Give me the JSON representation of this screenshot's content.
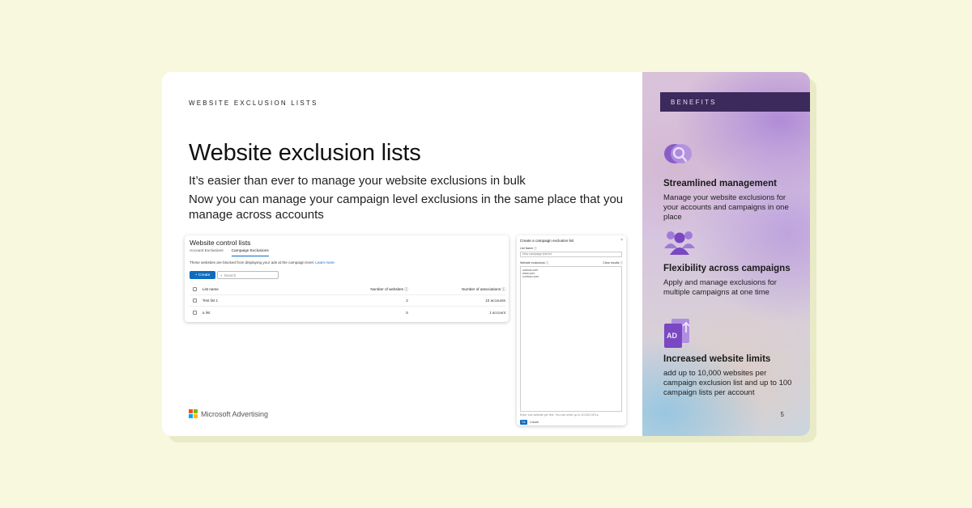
{
  "slide": {
    "eyebrow": "WEBSITE EXCLUSION LISTS",
    "title": "Website exclusion lists",
    "subtitle1": "It’s easier than ever to manage your website exclusions in bulk",
    "subtitle2": "Now you can manage your campaign level exclusions in the same place that you manage across accounts",
    "brand": "Microsoft Advertising",
    "page_number": "5"
  },
  "wcl": {
    "title": "Website control lists",
    "tabs": [
      "Account Exclusions",
      "Campaign Exclusions"
    ],
    "description": "These websites are blocked from displaying your ads at the campaign level.",
    "learn_more": "Learn more",
    "create_label": "+ Create",
    "search_placeholder": "Search",
    "columns": [
      "List name",
      "Number of websites ⓘ",
      "Number of associations ⓘ"
    ],
    "rows": [
      [
        "Test list 1",
        "2",
        "10 accounts"
      ],
      [
        "a list",
        "5",
        "1 account"
      ]
    ]
  },
  "dialog": {
    "title": "Create a campaign exclusion list",
    "close": "×",
    "list_name_label": "List Name ⓘ",
    "list_name_value": "New campaign test list",
    "websites_label": "Website exclusions ⓘ",
    "clear_label": "Clear results ⓘ",
    "websites": [
      "outlook.com",
      "www.com",
      "contoso.com"
    ],
    "note": "Enter one website per line. You can enter up to 10,000 URLs.",
    "ok_label": "Ok",
    "cancel_label": "Cancel"
  },
  "benefits": {
    "header": "BENEFITS",
    "items": [
      {
        "icon": "magnifier-icon",
        "title": "Streamlined management",
        "body": "Manage your website exclusions for your accounts and campaigns in one place"
      },
      {
        "icon": "people-icon",
        "title": "Flexibility across campaigns",
        "body": "Apply and manage exclusions for multiple campaigns at one time"
      },
      {
        "icon": "ad-document-icon",
        "title": "Increased website limits",
        "body": "add up to 10,000 websites per campaign exclusion list and up to 100 campaign lists per account"
      }
    ]
  },
  "colors": {
    "accent": "#0f6cbd",
    "benefits_bar": "#3d2a5c",
    "icon_purple": "#8a5cc7",
    "background": "#f7f8de"
  }
}
